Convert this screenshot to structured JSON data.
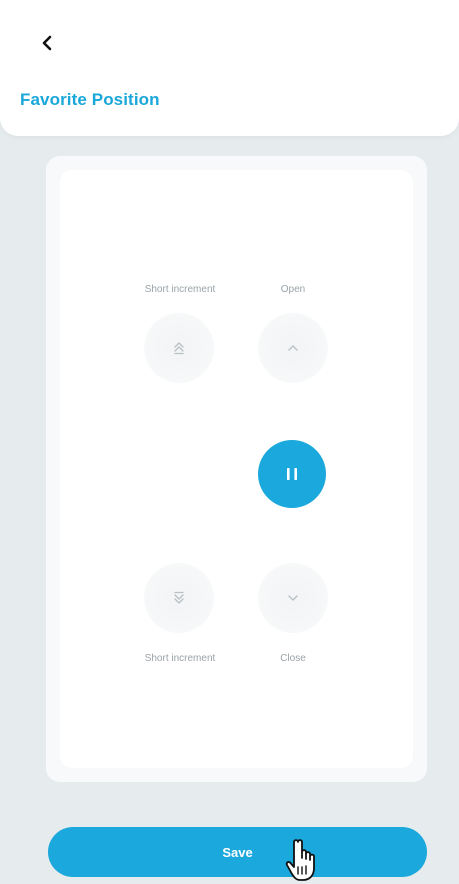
{
  "header": {
    "title": "Favorite Position"
  },
  "controls": {
    "short_increment_up_label": "Short increment",
    "open_label": "Open",
    "short_increment_down_label": "Short increment",
    "close_label": "Close"
  },
  "footer": {
    "save_label": "Save"
  },
  "colors": {
    "accent": "#1ba8dc",
    "title": "#1aa7d9",
    "label": "#9aa3a8",
    "background": "#e6eced"
  },
  "icons": {
    "back": "chevron-left-icon",
    "short_up": "short-increment-up-icon",
    "open": "chevron-up-icon",
    "pause": "pause-icon",
    "short_down": "short-increment-down-icon",
    "close": "chevron-down-icon",
    "cursor": "hand-pointer-icon"
  }
}
